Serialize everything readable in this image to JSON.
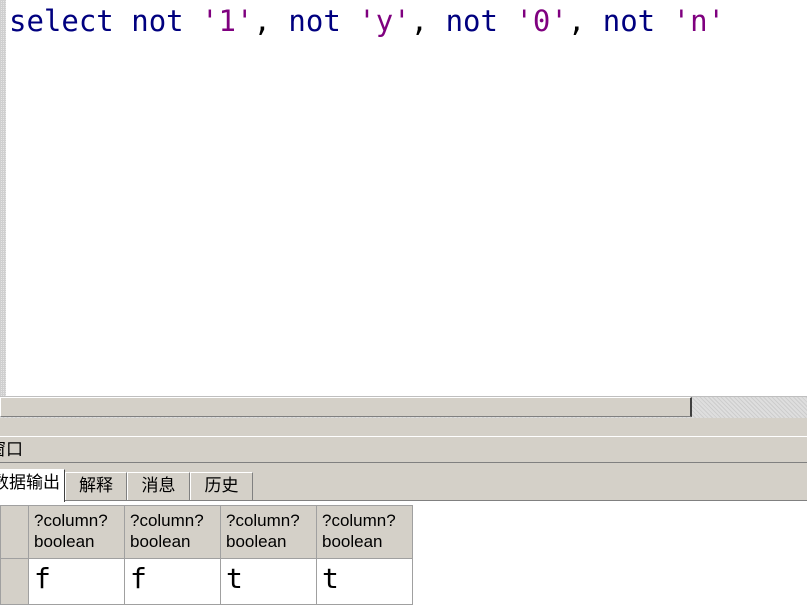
{
  "editor": {
    "sql_tokens": [
      {
        "text": "select",
        "kind": "kw"
      },
      {
        "text": " ",
        "kind": "punct"
      },
      {
        "text": "not",
        "kind": "kw"
      },
      {
        "text": " ",
        "kind": "punct"
      },
      {
        "text": "'1'",
        "kind": "str"
      },
      {
        "text": ", ",
        "kind": "punct"
      },
      {
        "text": "not",
        "kind": "kw"
      },
      {
        "text": " ",
        "kind": "punct"
      },
      {
        "text": "'y'",
        "kind": "str"
      },
      {
        "text": ", ",
        "kind": "punct"
      },
      {
        "text": "not",
        "kind": "kw"
      },
      {
        "text": " ",
        "kind": "punct"
      },
      {
        "text": "'0'",
        "kind": "str"
      },
      {
        "text": ", ",
        "kind": "punct"
      },
      {
        "text": "not",
        "kind": "kw"
      },
      {
        "text": " ",
        "kind": "punct"
      },
      {
        "text": "'n'",
        "kind": "str"
      }
    ],
    "colors": {
      "keyword": "#00007f",
      "string": "#7f007f"
    }
  },
  "output_pane": {
    "title": "窗口",
    "tabs": [
      {
        "label": "数据输出",
        "active": true
      },
      {
        "label": "解释",
        "active": false
      },
      {
        "label": "消息",
        "active": false
      },
      {
        "label": "历史",
        "active": false
      }
    ]
  },
  "results": {
    "columns": [
      {
        "name": "?column?",
        "type": "boolean"
      },
      {
        "name": "?column?",
        "type": "boolean"
      },
      {
        "name": "?column?",
        "type": "boolean"
      },
      {
        "name": "?column?",
        "type": "boolean"
      }
    ],
    "rows": [
      [
        "f",
        "f",
        "t",
        "t"
      ]
    ]
  }
}
